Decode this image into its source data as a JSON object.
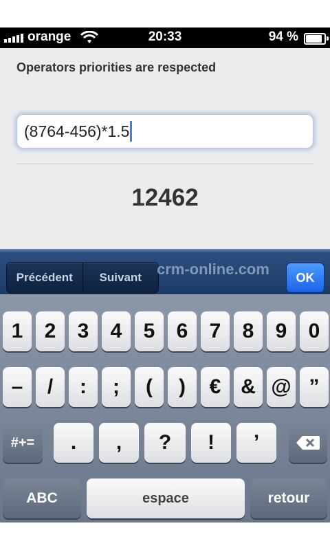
{
  "status_bar": {
    "carrier": "orange",
    "time": "20:33",
    "battery": "94 %"
  },
  "content": {
    "label": "Operators priorities are respected",
    "input_value": "(8764-456)*1.5",
    "result": "12462"
  },
  "toolbar": {
    "prev": "Précédent",
    "next": "Suivant",
    "watermark": "crm-online.com",
    "ok": "OK"
  },
  "keyboard": {
    "row1": [
      "1",
      "2",
      "3",
      "4",
      "5",
      "6",
      "7",
      "8",
      "9",
      "0"
    ],
    "row2": [
      "–",
      "/",
      ":",
      ";",
      "(",
      ")",
      "€",
      "&",
      "@",
      "”"
    ],
    "row3_mode": "#+=",
    "row3": [
      ".",
      ",",
      "?",
      "!",
      "’"
    ],
    "abc": "ABC",
    "space": "espace",
    "return": "retour"
  },
  "colors": {
    "ok_button": "#1c62e6",
    "toolbar": "#1d3a66",
    "focus_glow": "#8cafe6"
  }
}
